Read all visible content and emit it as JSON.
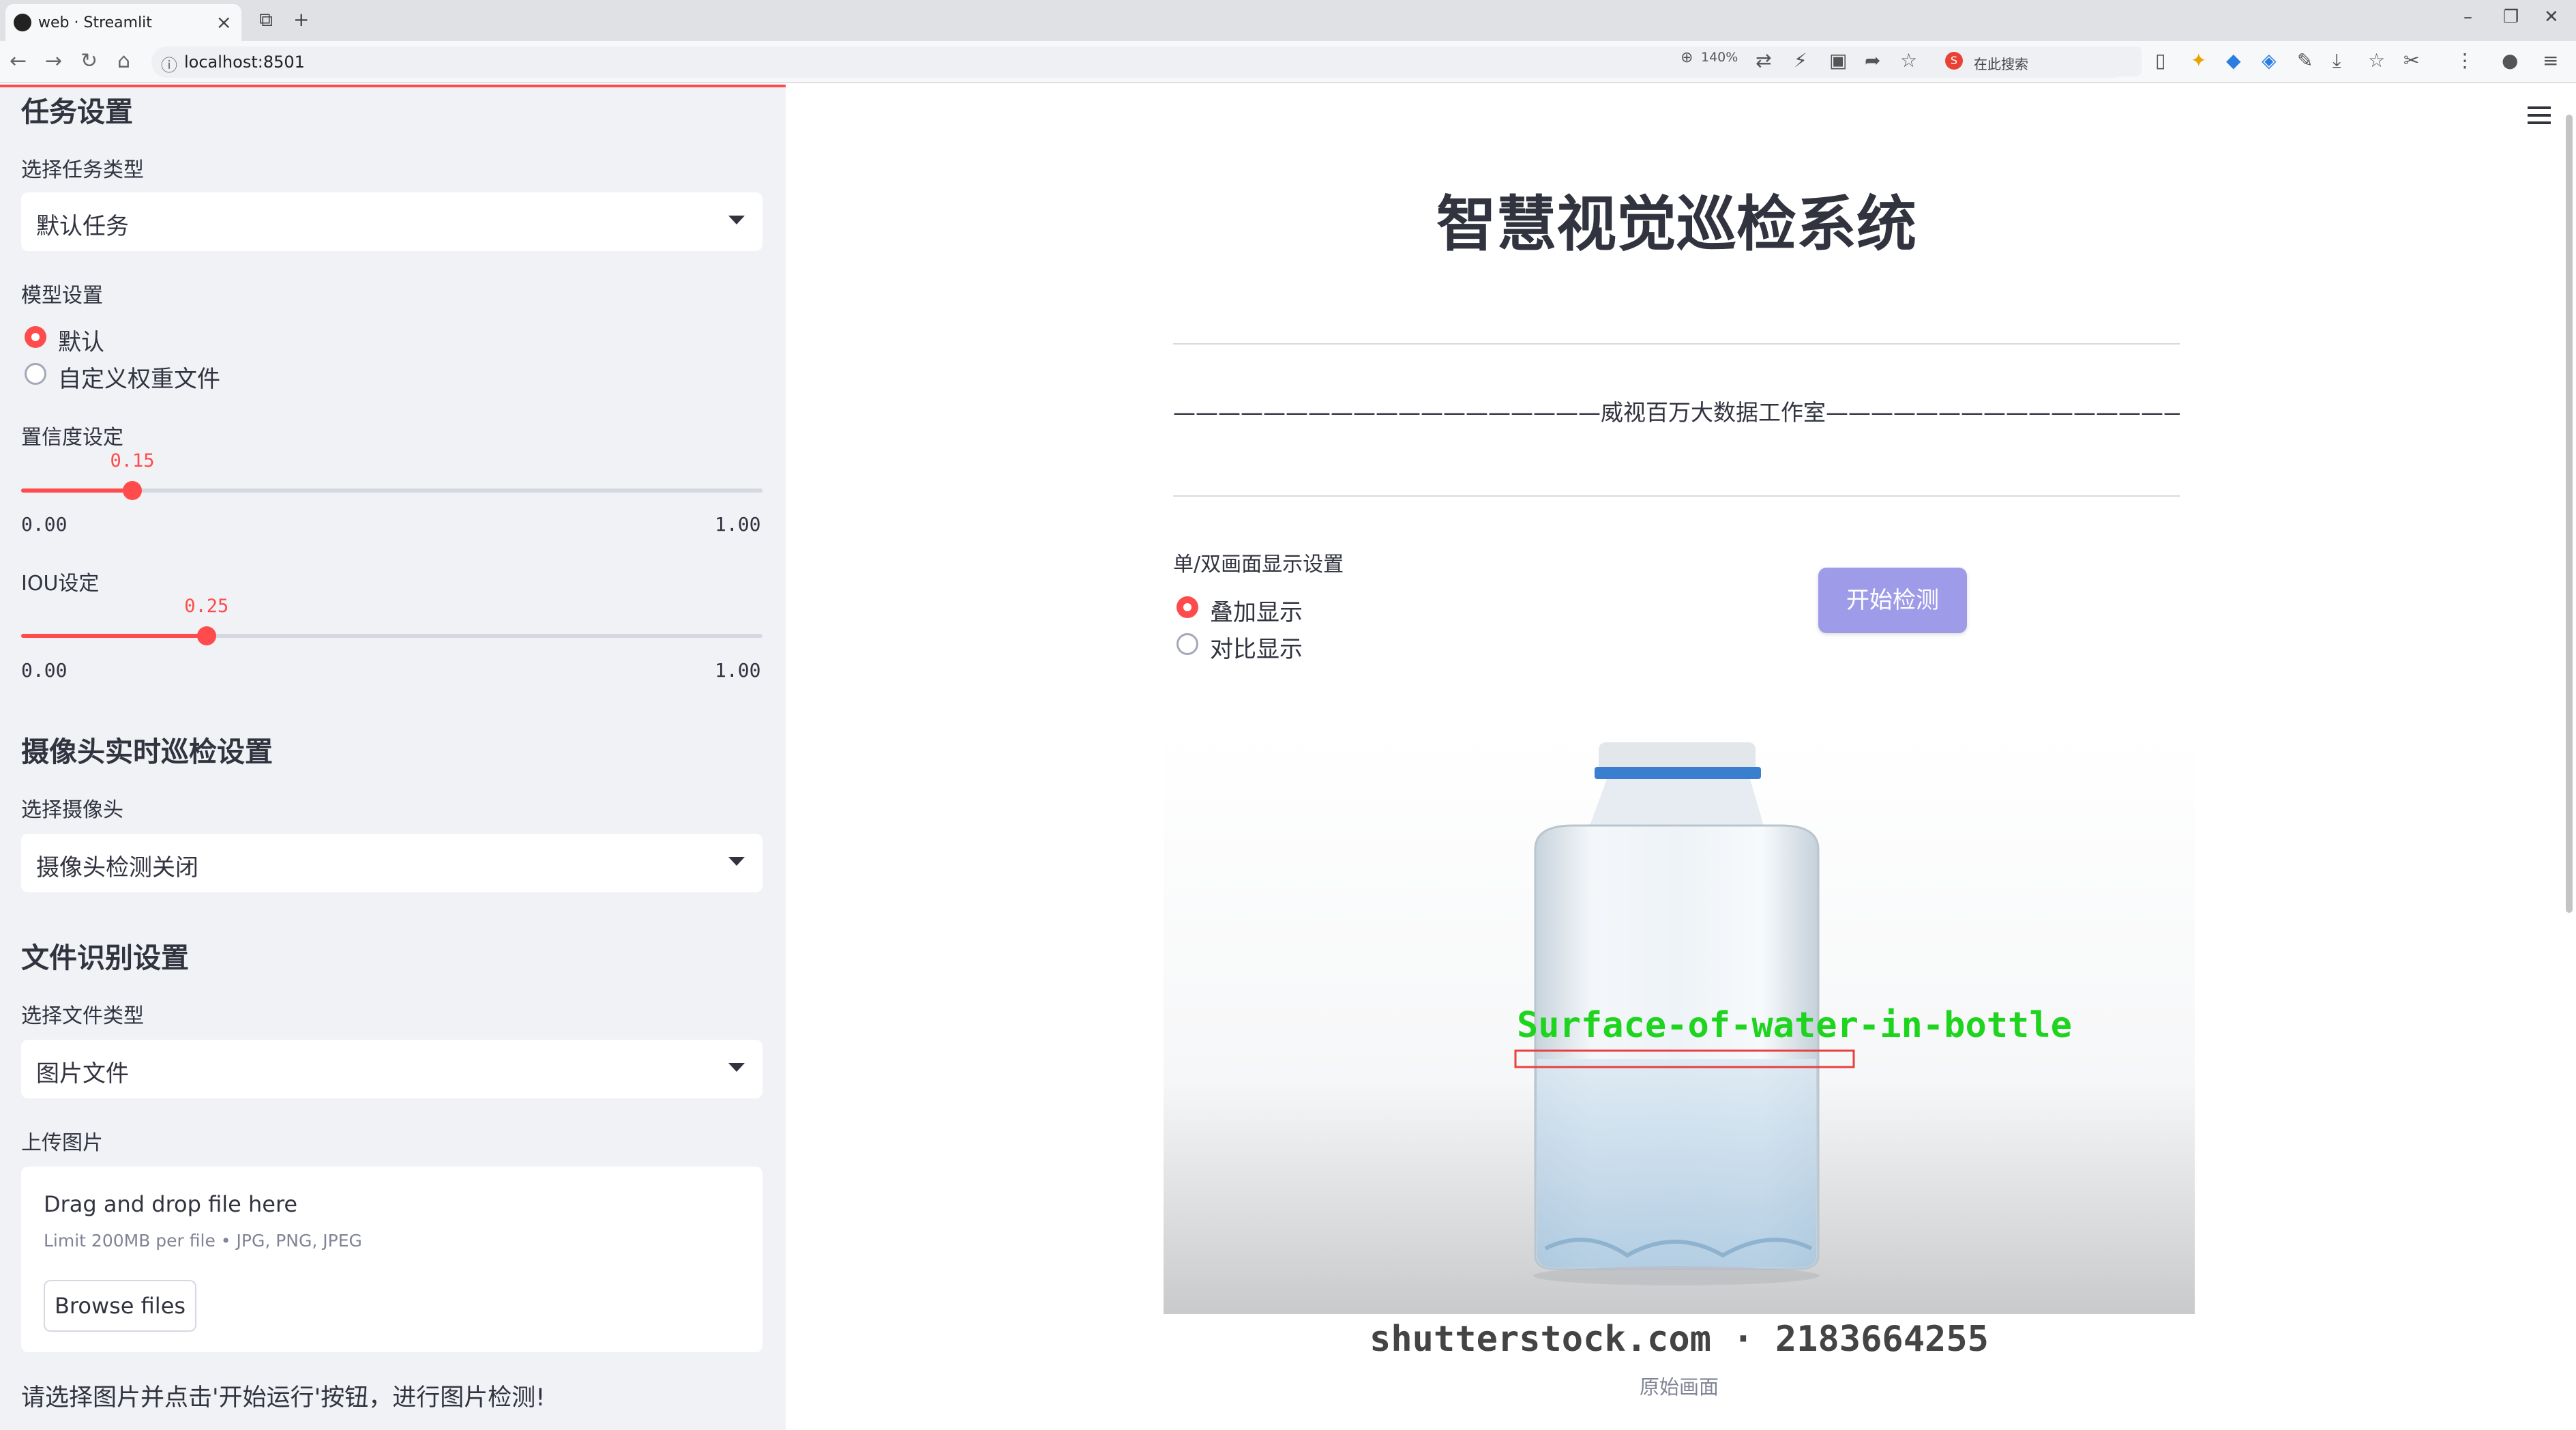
{
  "browser": {
    "tab_title": "web · Streamlit",
    "url": "localhost:8501",
    "zoom": "140%",
    "search_placeholder": "在此搜索"
  },
  "sidebar": {
    "task_section_title": "任务设置",
    "task_type_label": "选择任务类型",
    "task_type_value": "默认任务",
    "model_label": "模型设置",
    "model_options": [
      "默认",
      "自定义权重文件"
    ],
    "model_selected": "默认",
    "confidence_label": "置信度设定",
    "confidence_value": "0.15",
    "confidence_min": "0.00",
    "confidence_max": "1.00",
    "iou_label": "IOU设定",
    "iou_value": "0.25",
    "iou_min": "0.00",
    "iou_max": "1.00",
    "camera_section_title": "摄像头实时巡检设置",
    "camera_label": "选择摄像头",
    "camera_value": "摄像头检测关闭",
    "file_section_title": "文件识别设置",
    "file_type_label": "选择文件类型",
    "file_type_value": "图片文件",
    "upload_label": "上传图片",
    "upload_drop_text": "Drag and drop file here",
    "upload_limit_text": "Limit 200MB per file • JPG, PNG, JPEG",
    "browse_label": "Browse files",
    "note": "请选择图片并点击'开始运行'按钮，进行图片检测!"
  },
  "main": {
    "title": "智慧视觉巡检系统",
    "subtitle": "———————————————————威视百万大数据工作室————————————————————",
    "display_label": "单/双画面显示设置",
    "display_options": [
      "叠加显示",
      "对比显示"
    ],
    "display_selected": "叠加显示",
    "start_button": "开始检测",
    "detection_label": "Surface-of-water-in-bottle",
    "watermark": "shutterstock.com · 2183664255",
    "image_caption": "原始画面"
  },
  "colors": {
    "accent": "#ff4b4b",
    "button": "#9e9ce8",
    "sidebar_bg": "#f0f2f6",
    "detection_box": "#e8403f",
    "detection_text": "#1fd41f"
  }
}
